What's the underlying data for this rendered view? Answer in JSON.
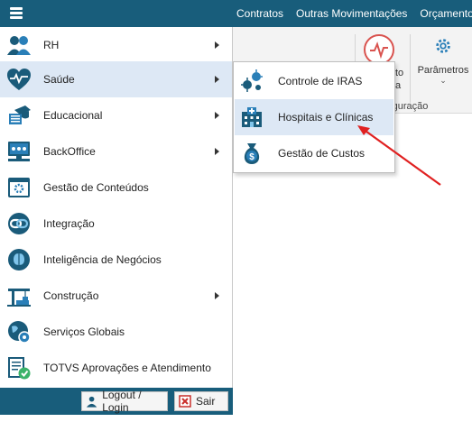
{
  "topbar": {
    "menu_items": [
      "Contratos",
      "Outras Movimentações",
      "Orçamento"
    ]
  },
  "ribbon": {
    "partial_label_1": "to",
    "partial_label_2": "a",
    "parametros_label": "Parâmetros",
    "group_label": "nfiguração"
  },
  "sidebar": {
    "items": [
      {
        "label": "RH",
        "icon": "people-icon",
        "has_submenu": true
      },
      {
        "label": "Saúde",
        "icon": "heart-pulse-icon",
        "has_submenu": true,
        "active": true
      },
      {
        "label": "Educacional",
        "icon": "graduation-icon",
        "has_submenu": true
      },
      {
        "label": "BackOffice",
        "icon": "monitor-icon",
        "has_submenu": true
      },
      {
        "label": "Gestão de Conteúdos",
        "icon": "content-window-icon",
        "has_submenu": false
      },
      {
        "label": "Integração",
        "icon": "chain-link-icon",
        "has_submenu": false
      },
      {
        "label": "Inteligência de Negócios",
        "icon": "brain-icon",
        "has_submenu": false
      },
      {
        "label": "Construção",
        "icon": "crane-icon",
        "has_submenu": true
      },
      {
        "label": "Serviços Globais",
        "icon": "globe-icon",
        "has_submenu": false
      },
      {
        "label": "TOTVS Aprovações e Atendimento",
        "icon": "approval-doc-icon",
        "has_submenu": false
      }
    ]
  },
  "bottombar": {
    "logout_label": "Logout / Login",
    "sair_label": "Sair"
  },
  "submenu": {
    "items": [
      {
        "label": "Controle de IRAS",
        "icon": "bacteria-icon"
      },
      {
        "label": "Hospitais e Clínicas",
        "icon": "hospital-icon",
        "active": true
      },
      {
        "label": "Gestão de Custos",
        "icon": "money-bag-icon"
      }
    ]
  },
  "colors": {
    "brand": "#185d7b",
    "active_bg": "#dde8f5",
    "annotation_arrow": "#e02020"
  }
}
